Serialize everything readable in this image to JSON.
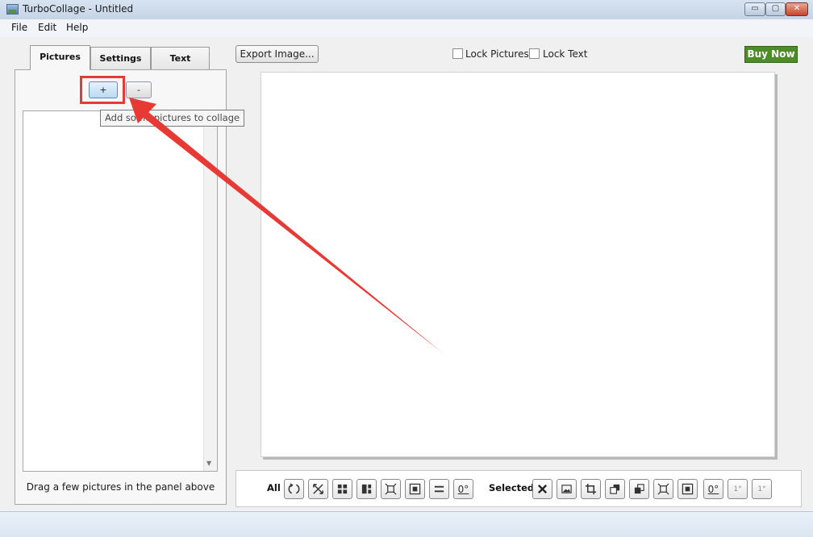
{
  "window": {
    "title": "TurboCollage - Untitled",
    "min_symbol": "▭",
    "max_symbol": "▢",
    "close_symbol": "✕"
  },
  "menu": [
    "File",
    "Edit",
    "Help"
  ],
  "tabs": [
    "Pictures",
    "Settings",
    "Text"
  ],
  "pictures_panel": {
    "add_button": "+",
    "remove_button": "-",
    "tooltip": "Add some pictures to collage",
    "drag_hint": "Drag a few pictures in the panel above",
    "scroll_arrow": "▼"
  },
  "top_toolbar": {
    "export_button": "Export Image...",
    "lock_pictures": "Lock Pictures",
    "lock_text": "Lock Text",
    "buy_now": "Buy Now"
  },
  "bottom_toolbar": {
    "all_label": "All",
    "selected_label": "Selected",
    "degree_label": "0°",
    "rotate_right_label": "1°",
    "rotate_left_label": "1°"
  },
  "colors": {
    "annotation_red": "#e83a35",
    "buy_now_green": "#4e8c27"
  },
  "icons": {
    "all": [
      "refresh-icon",
      "shuffle-icon",
      "grid-layout-icon",
      "mosaic-layout-icon",
      "fit-icon",
      "fill-icon",
      "equal-spacing-icon",
      "rotate-zero-icon"
    ],
    "selected": [
      "delete-icon",
      "replace-image-icon",
      "crop-icon",
      "bring-forward-icon",
      "send-backward-icon",
      "fit-icon",
      "fill-icon",
      "rotate-zero-icon",
      "rotate-right-icon",
      "rotate-left-icon"
    ]
  }
}
